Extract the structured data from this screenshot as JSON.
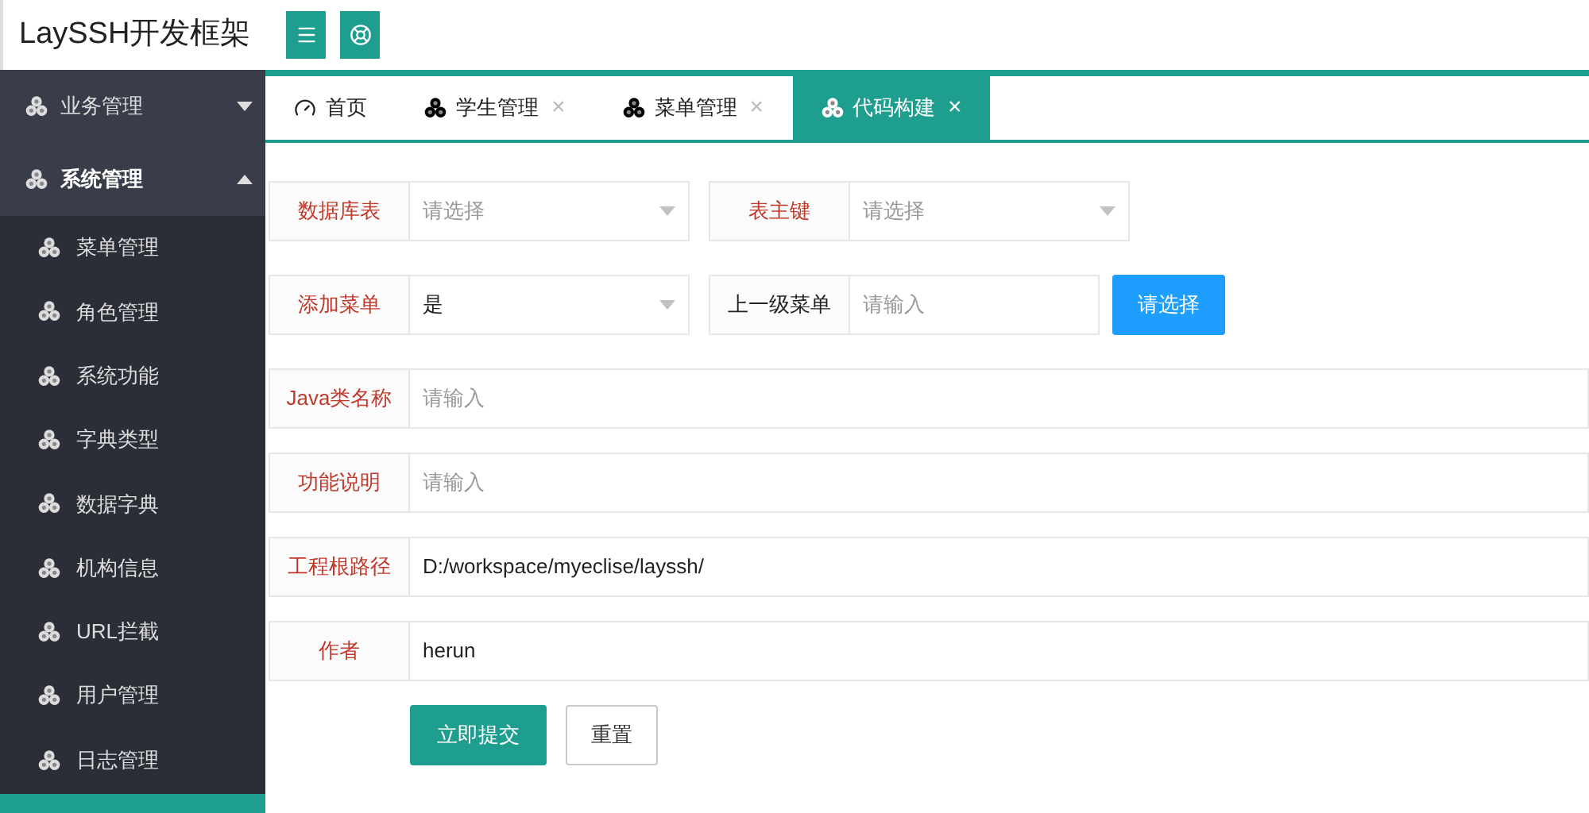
{
  "header": {
    "logo": "LaySSH开发框架"
  },
  "sidebar": {
    "groups": [
      {
        "label": "业务管理",
        "expanded": false
      },
      {
        "label": "系统管理",
        "expanded": true,
        "children": [
          {
            "label": "菜单管理",
            "selected": false
          },
          {
            "label": "角色管理",
            "selected": false
          },
          {
            "label": "系统功能",
            "selected": false
          },
          {
            "label": "字典类型",
            "selected": false
          },
          {
            "label": "数据字典",
            "selected": false
          },
          {
            "label": "机构信息",
            "selected": false
          },
          {
            "label": "URL拦截",
            "selected": false
          },
          {
            "label": "用户管理",
            "selected": false
          },
          {
            "label": "日志管理",
            "selected": false
          }
        ]
      }
    ]
  },
  "tabs": [
    {
      "label": "首页",
      "kind": "home",
      "closable": false,
      "selected": false
    },
    {
      "label": "学生管理",
      "kind": "page",
      "closable": true,
      "selected": false
    },
    {
      "label": "菜单管理",
      "kind": "page",
      "closable": true,
      "selected": false
    },
    {
      "label": "代码构建",
      "kind": "page",
      "closable": true,
      "selected": true
    }
  ],
  "close_glyph": "×",
  "form": {
    "rows": [
      {
        "kind": "pair",
        "fields": [
          {
            "label": "数据库表",
            "required": true,
            "kind": "select",
            "placeholder": "请选择"
          },
          {
            "label": "表主键",
            "required": true,
            "kind": "select",
            "placeholder": "请选择"
          }
        ]
      },
      {
        "kind": "pair",
        "fields": [
          {
            "label": "添加菜单",
            "required": true,
            "kind": "select",
            "value": "是"
          },
          {
            "label": "上一级菜单",
            "required": false,
            "kind": "input",
            "placeholder": "请输入"
          }
        ],
        "button": "请选择"
      },
      {
        "kind": "full",
        "fields": [
          {
            "label": "Java类名称",
            "required": true,
            "kind": "input",
            "placeholder": "请输入"
          }
        ]
      },
      {
        "kind": "full",
        "fields": [
          {
            "label": "功能说明",
            "required": true,
            "kind": "input",
            "placeholder": "请输入"
          }
        ]
      },
      {
        "kind": "full",
        "fields": [
          {
            "label": "工程根路径",
            "required": true,
            "kind": "input",
            "value": "D:/workspace/myeclise/layssh/"
          }
        ]
      },
      {
        "kind": "full",
        "fields": [
          {
            "label": "作者",
            "required": true,
            "kind": "input",
            "value": "herun"
          }
        ]
      }
    ],
    "submit": "立即提交",
    "reset": "重置"
  }
}
